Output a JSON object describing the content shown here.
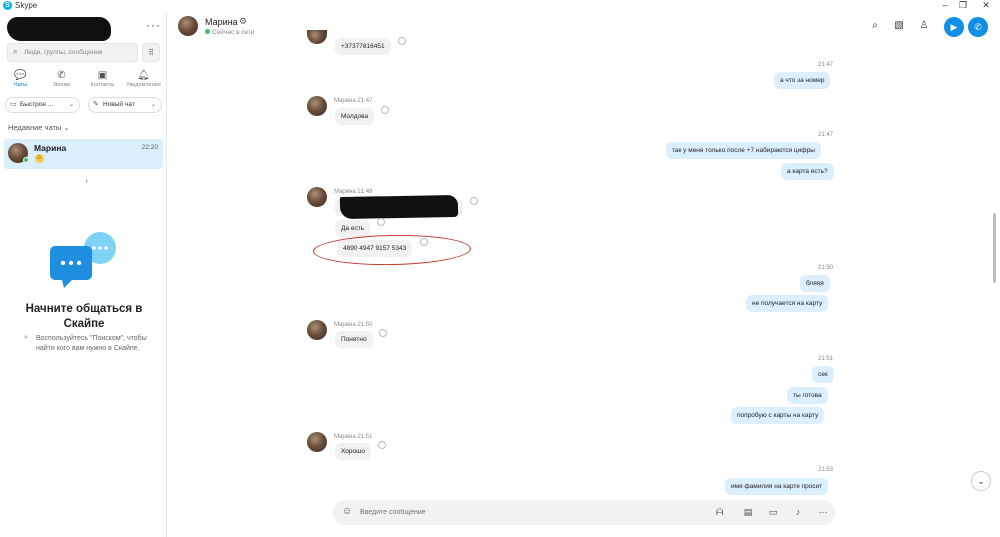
{
  "window": {
    "title": "Skype",
    "controls": [
      "–",
      "❐",
      "✕"
    ]
  },
  "sidebar": {
    "search_placeholder": "Люди, группы, сообщения",
    "tabs": [
      {
        "label": "Чаты",
        "icon": "chat-icon"
      },
      {
        "label": "Звонки",
        "icon": "phone-icon"
      },
      {
        "label": "Контакты",
        "icon": "contacts-icon"
      },
      {
        "label": "Уведомления",
        "icon": "bell-icon"
      }
    ],
    "quick_label": "Быстрое ...",
    "newchat_label": "Новый чат",
    "recent_label": "Недавние чаты ⌄",
    "chat": {
      "name": "Марина",
      "time": "22:20"
    },
    "welcome_title": "Начните общаться в Скайпе",
    "welcome_text": "Воспользуйтесь \"Поиском\", чтобы найти кого вам нужно в Скайпе."
  },
  "header": {
    "name": "Марина",
    "status": "Сейчас в сети"
  },
  "messages": {
    "m0": "+37377816451",
    "t1": "21:47",
    "o1": "а что за номер",
    "meta2": "Марина 21:47",
    "m2": "Молдова",
    "t3": "21:47",
    "o3a": "так у меня только после +7 набираются цифры",
    "o3b": "а карта есть?",
    "meta4": "Марина 21:48",
    "m4a": "Т",
    "m4b": "Да есть",
    "m4c": "4890 4947 9157 5343",
    "t5": "21:50",
    "o5a": "бляяя",
    "o5b": "не получается на карту",
    "meta6": "Марина 21:50",
    "m6": "Понятно",
    "t7": "21:51",
    "o7a": "сек",
    "o7b": "ты готова",
    "o7c": "попробую с карты на карту",
    "meta8": "Марина 21:51",
    "m8": "Хорошо",
    "t9": "21:53",
    "o9": "имя фамилия на карте просит"
  },
  "composer": {
    "placeholder": "Введите сообщение"
  },
  "colors": {
    "accent": "#0f8fe8",
    "incoming": "#f1f1f1",
    "outgoing": "#dcefff",
    "online": "#35c459",
    "annotation": "#c0392b"
  }
}
